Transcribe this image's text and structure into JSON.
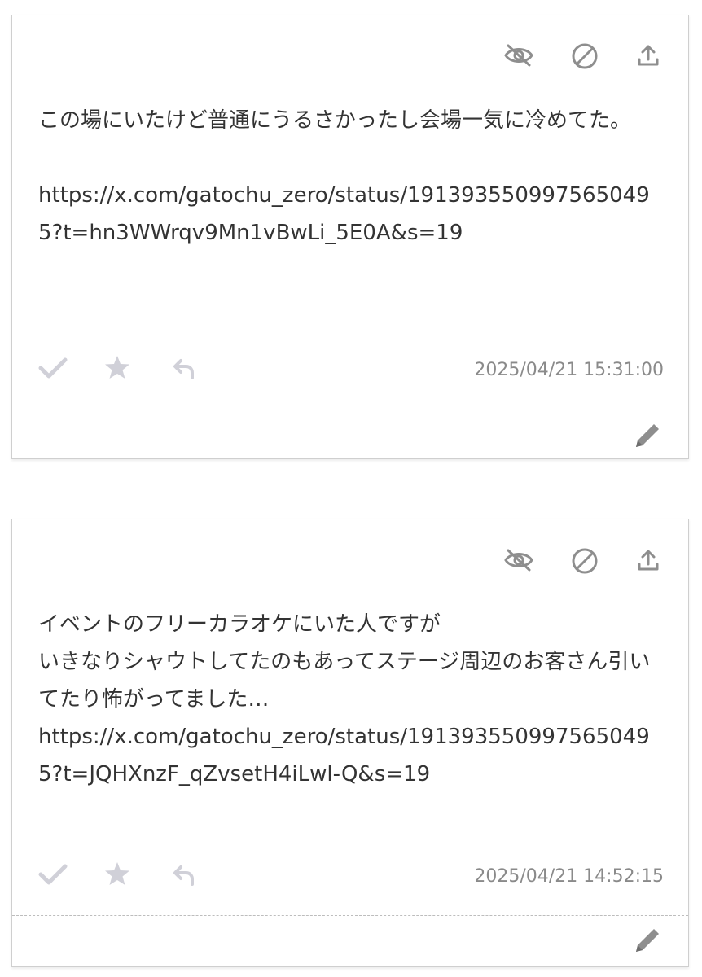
{
  "colors": {
    "text": "#333333",
    "icon": "#8e8e8e",
    "action_icon": "#d0d0d8",
    "timestamp": "#8a8a8a",
    "border": "#cfcfcf"
  },
  "cards": [
    {
      "message": "この場にいたけど普通にうるさかったし会場一気に冷めてた。\n\nhttps://x.com/gatochu_zero/status/1913935509975650495?t=hn3WWrqv9Mn1vBwLi_5E0A&s=19",
      "timestamp": "2025/04/21 15:31:00",
      "icons": [
        "eye-off-icon",
        "block-icon",
        "share-icon",
        "check-icon",
        "star-icon",
        "reply-icon",
        "pencil-icon"
      ]
    },
    {
      "message": "イベントのフリーカラオケにいた人ですが\nいきなりシャウトしてたのもあってステージ周辺のお客さん引いてたり怖がってました…\nhttps://x.com/gatochu_zero/status/1913935509975650495?t=JQHXnzF_qZvsetH4iLwl-Q&s=19",
      "timestamp": "2025/04/21 14:52:15",
      "icons": [
        "eye-off-icon",
        "block-icon",
        "share-icon",
        "check-icon",
        "star-icon",
        "reply-icon",
        "pencil-icon"
      ]
    }
  ]
}
